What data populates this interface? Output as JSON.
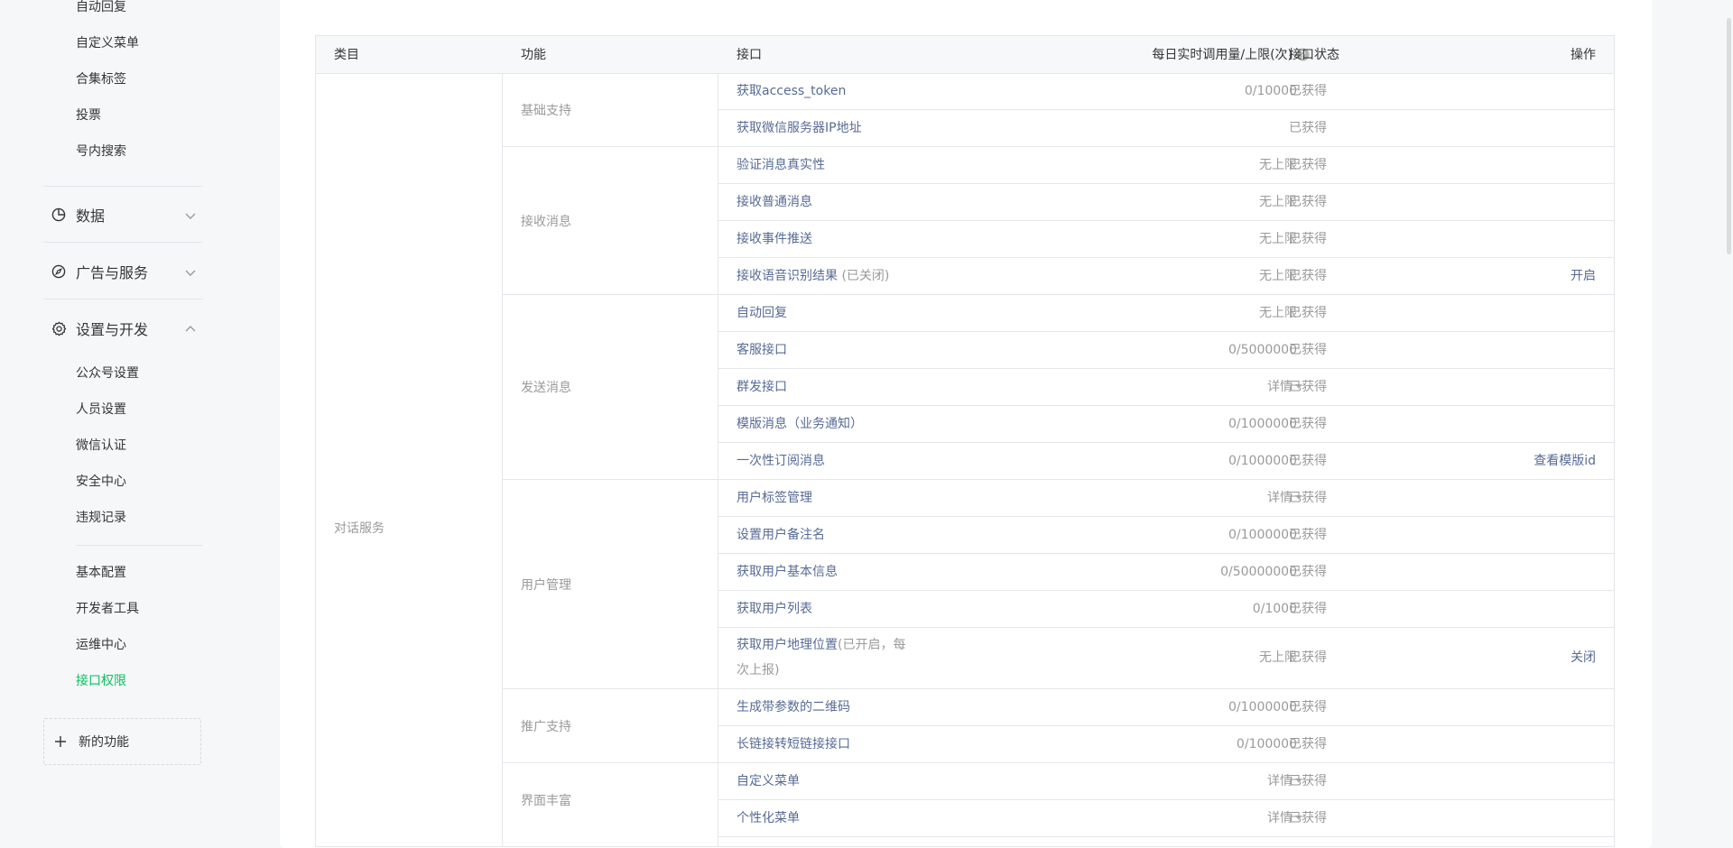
{
  "sidebar": {
    "top_items": [
      "自动回复",
      "自定义菜单",
      "合集标签",
      "投票",
      "号内搜索"
    ],
    "groups": [
      {
        "label": "数据",
        "icon": "pie-chart-icon",
        "expanded": false
      },
      {
        "label": "广告与服务",
        "icon": "compass-icon",
        "expanded": false
      },
      {
        "label": "设置与开发",
        "icon": "gear-icon",
        "expanded": true
      }
    ],
    "settings_items": [
      "公众号设置",
      "人员设置",
      "微信认证",
      "安全中心",
      "违规记录"
    ],
    "dev_items": [
      "基本配置",
      "开发者工具",
      "运维中心",
      "接口权限"
    ],
    "active_item": "接口权限",
    "new_feature_label": "新的功能",
    "accent_color": "#07c160"
  },
  "table": {
    "headers": {
      "category": "类目",
      "function": "功能",
      "api": "接口",
      "quota": "每日实时调用量/上限(次)",
      "status": "接口状态",
      "operation": "操作"
    },
    "category": "对话服务",
    "functions": [
      "基础支持",
      "接收消息",
      "发送消息",
      "用户管理",
      "推广支持",
      "界面丰富"
    ],
    "rows": [
      {
        "api": "获取access_token",
        "note": "",
        "quota": "0/10000",
        "status": "已获得",
        "op": ""
      },
      {
        "api": "获取微信服务器IP地址",
        "note": "",
        "quota": "",
        "status": "已获得",
        "op": ""
      },
      {
        "api": "验证消息真实性",
        "note": "",
        "quota": "无上限",
        "status": "已获得",
        "op": ""
      },
      {
        "api": "接收普通消息",
        "note": "",
        "quota": "无上限",
        "status": "已获得",
        "op": ""
      },
      {
        "api": "接收事件推送",
        "note": "",
        "quota": "无上限",
        "status": "已获得",
        "op": ""
      },
      {
        "api": "接收语音识别结果",
        "note": " (已关闭)",
        "quota": "无上限",
        "status": "已获得",
        "op": "开启"
      },
      {
        "api": "自动回复",
        "note": "",
        "quota": "无上限",
        "status": "已获得",
        "op": ""
      },
      {
        "api": "客服接口",
        "note": "",
        "quota": "0/5000000",
        "status": "已获得",
        "op": ""
      },
      {
        "api": "群发接口",
        "note": "",
        "quota": "详情",
        "status": "已获得",
        "op": ""
      },
      {
        "api": "模版消息（业务通知）",
        "note": "",
        "quota": "0/1000000",
        "status": "已获得",
        "op": ""
      },
      {
        "api": "一次性订阅消息",
        "note": "",
        "quota": "0/1000000",
        "status": "已获得",
        "op": "查看模版id"
      },
      {
        "api": "用户标签管理",
        "note": "",
        "quota": "详情",
        "status": "已获得",
        "op": ""
      },
      {
        "api": "设置用户备注名",
        "note": "",
        "quota": "0/1000000",
        "status": "已获得",
        "op": ""
      },
      {
        "api": "获取用户基本信息",
        "note": "",
        "quota": "0/50000000",
        "status": "已获得",
        "op": ""
      },
      {
        "api": "获取用户列表",
        "note": "",
        "quota": "0/1000",
        "status": "已获得",
        "op": ""
      },
      {
        "api": "获取用户地理位置",
        "note": "(已开启，每",
        "api2": "次上报)",
        "quota": "无上限",
        "status": "已获得",
        "op": "关闭"
      },
      {
        "api": "生成带参数的二维码",
        "note": "",
        "quota": "0/1000000",
        "status": "已获得",
        "op": ""
      },
      {
        "api": "长链接转短链接接口",
        "note": "",
        "quota": "0/100000",
        "status": "已获得",
        "op": ""
      },
      {
        "api": "自定义菜单",
        "note": "",
        "quota": "详情",
        "status": "已获得",
        "op": ""
      },
      {
        "api": "个性化菜单",
        "note": "",
        "quota": "详情",
        "status": "已获得",
        "op": ""
      }
    ],
    "link_color": "#576b95",
    "muted_color": "#9a9a9a"
  }
}
